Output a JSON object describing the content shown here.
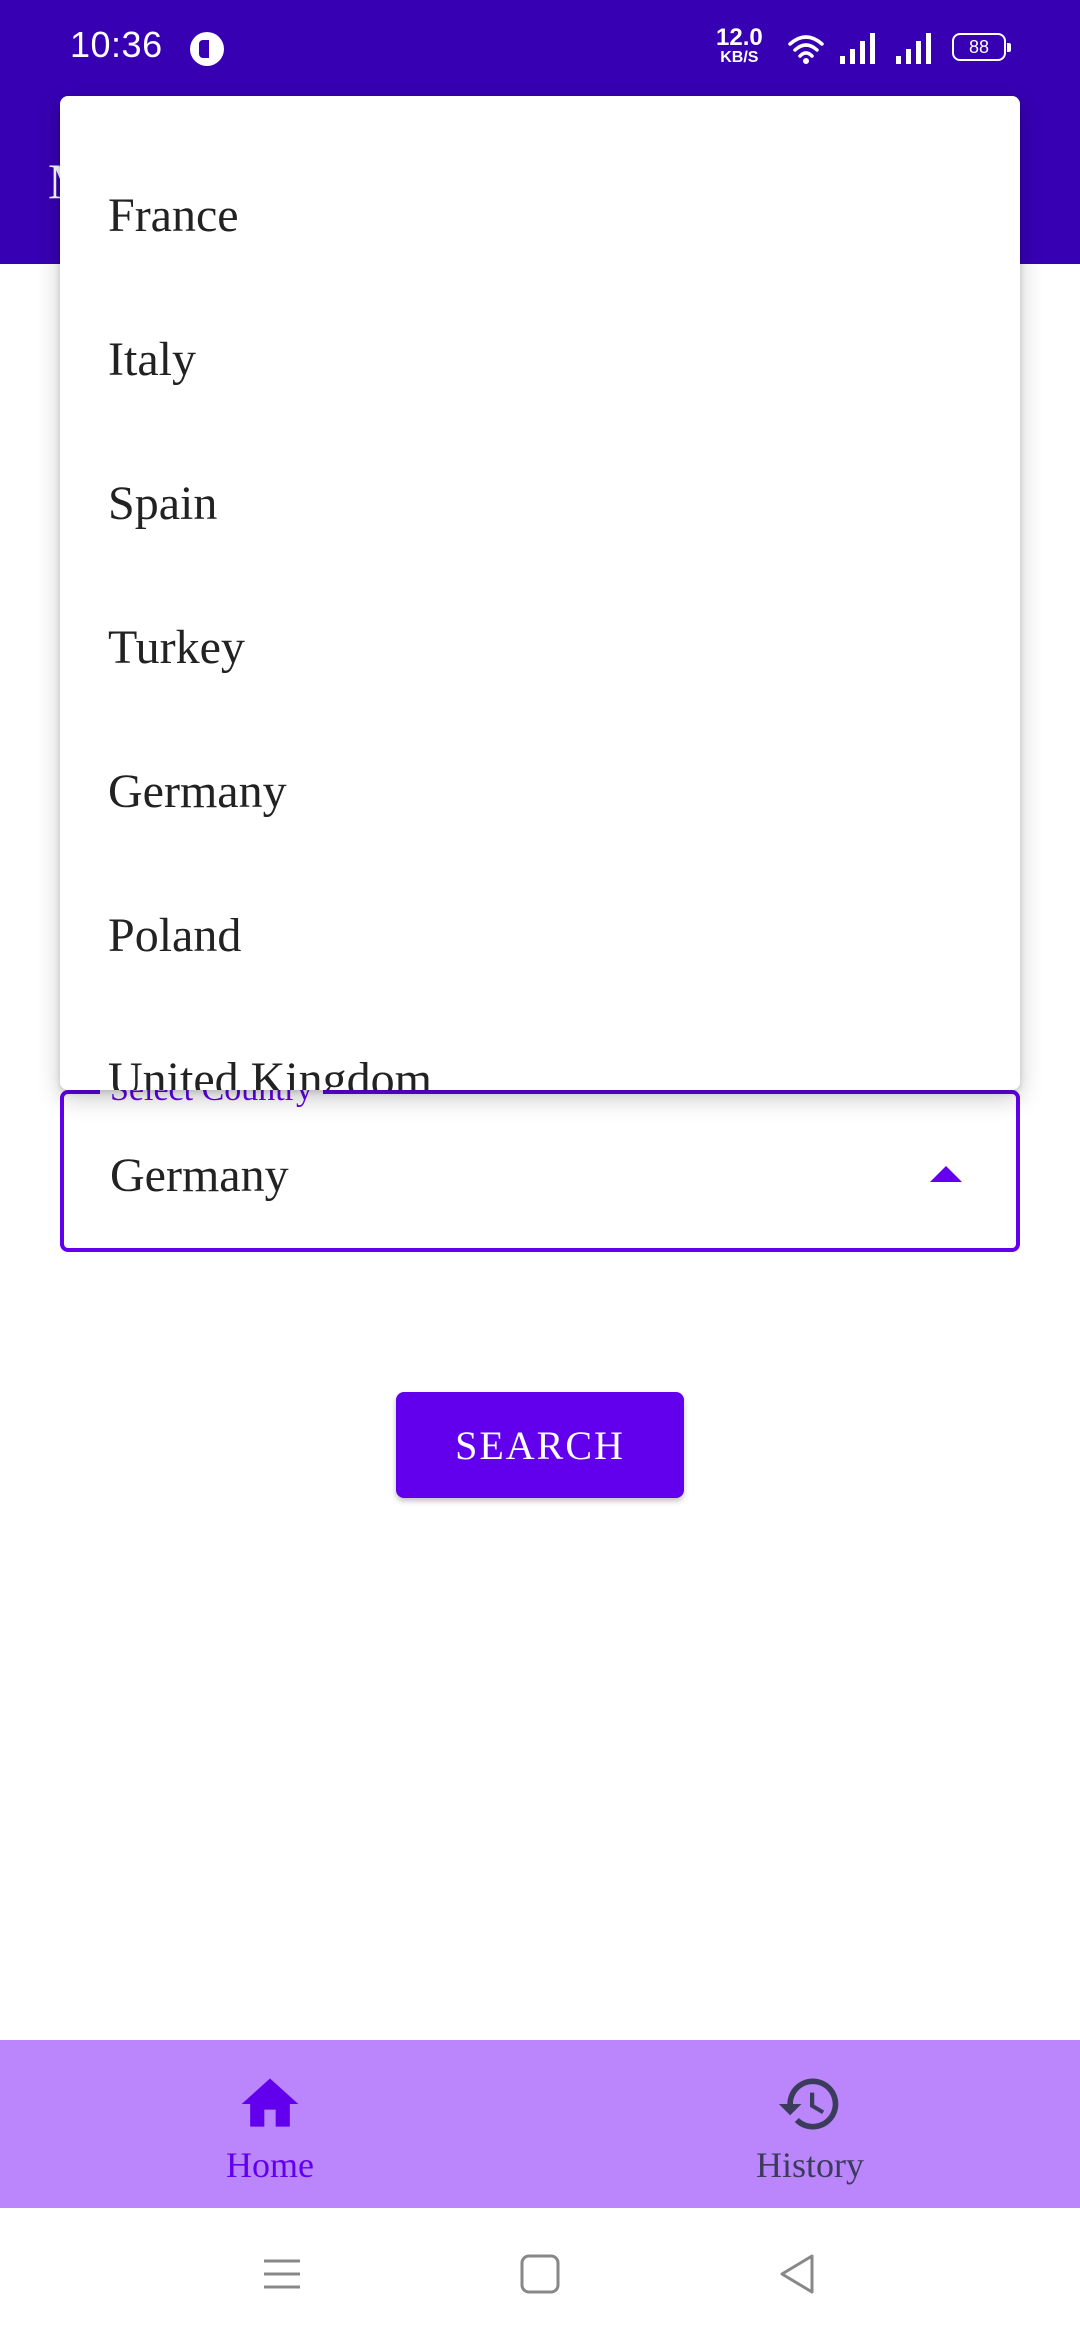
{
  "status_bar": {
    "time": "10:36",
    "net_speed": "12.0",
    "net_unit": "KB/S",
    "battery": "88"
  },
  "app_bar": {
    "title": "M"
  },
  "select": {
    "label": "Select Country",
    "value": "Germany"
  },
  "dropdown": {
    "options": [
      "France",
      "Italy",
      "Spain",
      "Turkey",
      "Germany",
      "Poland",
      "United Kingdom"
    ]
  },
  "search_button": {
    "label": "SEARCH"
  },
  "bottom_nav": {
    "items": [
      {
        "label": "Home",
        "icon": "home-icon",
        "selected": true
      },
      {
        "label": "History",
        "icon": "history-icon",
        "selected": false
      }
    ]
  },
  "colors": {
    "primary": "#6200ee",
    "primary_dark": "#3700b3",
    "nav_background": "#bb86fc"
  }
}
